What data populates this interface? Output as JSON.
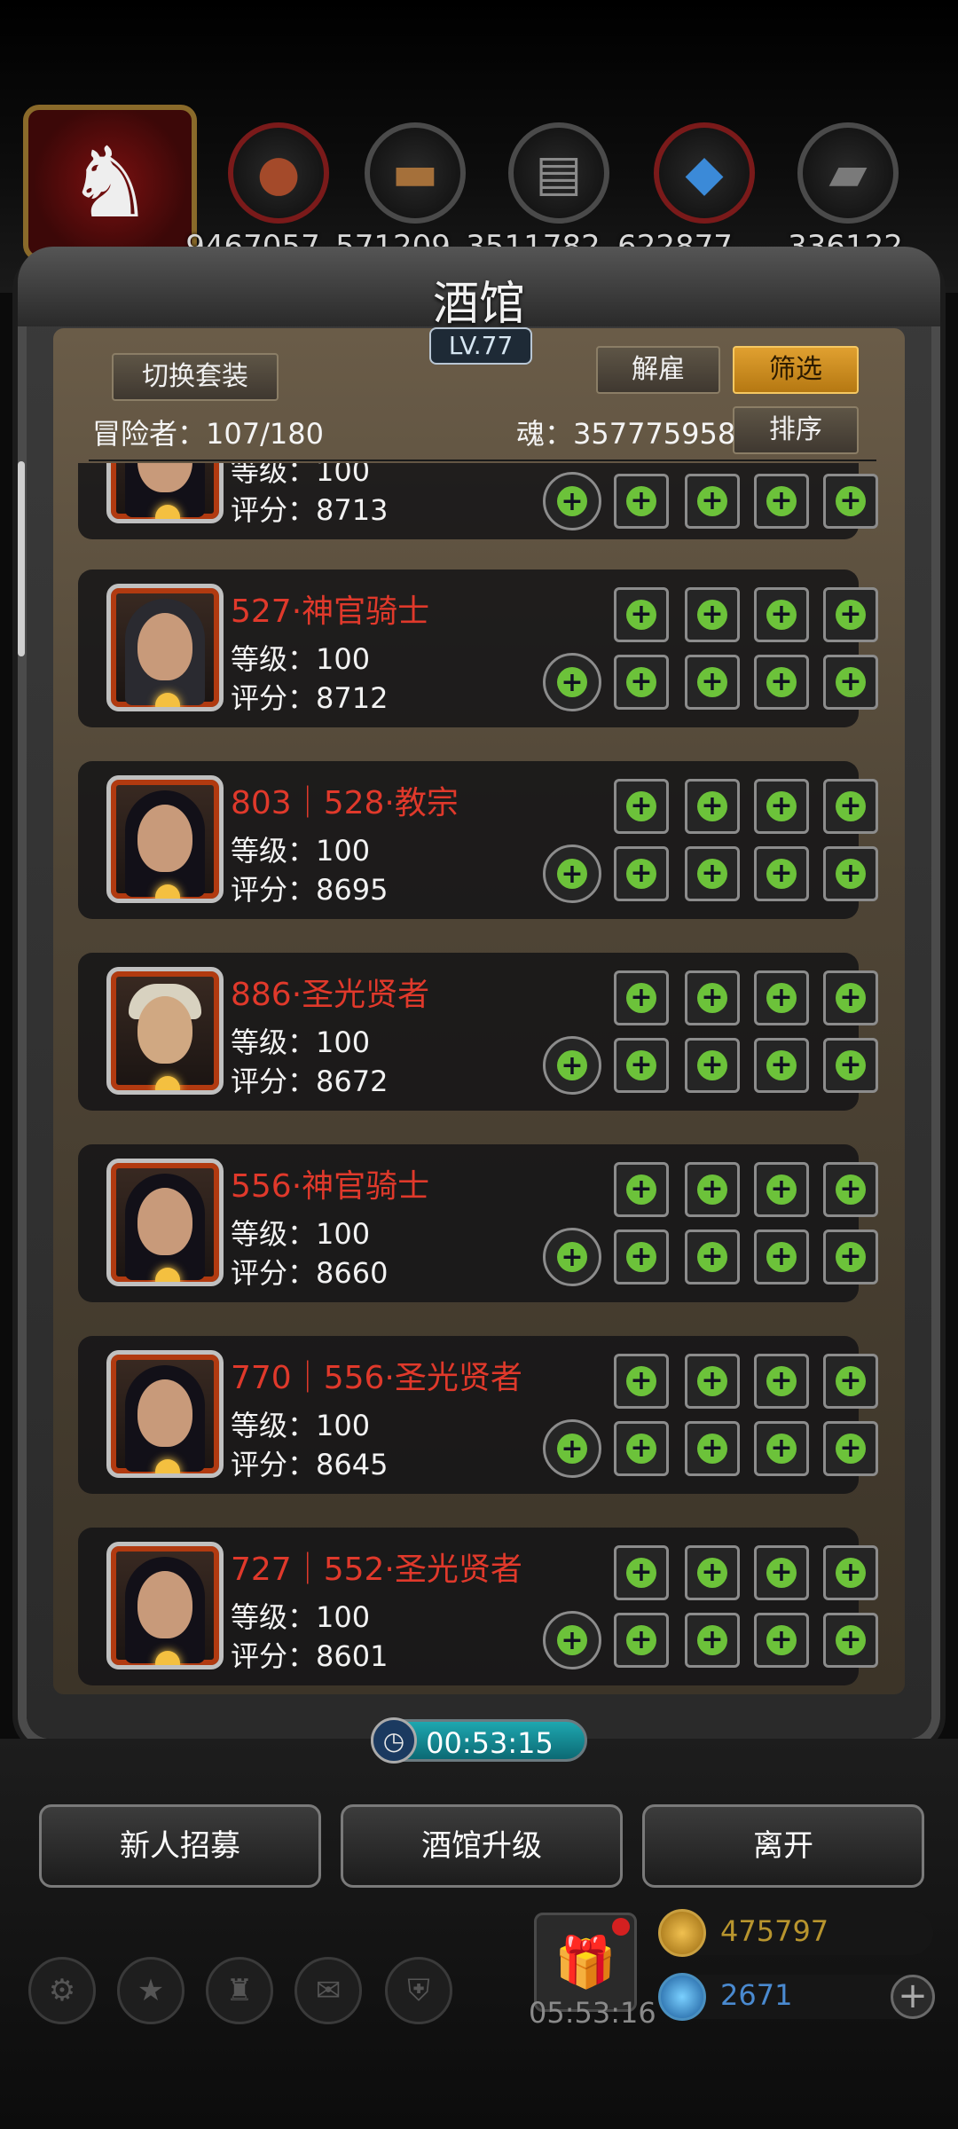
{
  "resources": [
    {
      "icon": "meat-icon",
      "value": "9467057"
    },
    {
      "icon": "wood-icon",
      "value": "571209"
    },
    {
      "icon": "iron-icon",
      "value": "3511782"
    },
    {
      "icon": "crystal-icon",
      "value": "622877"
    },
    {
      "icon": "stone-icon",
      "value": "336122"
    }
  ],
  "panel": {
    "title": "酒馆",
    "level": "LV.77",
    "switch_set_label": "切换套装",
    "dismiss_label": "解雇",
    "filter_label": "筛选",
    "sort_label": "排序",
    "adventurer_label": "冒险者：107/180",
    "soul_label": "魂：357775958"
  },
  "heroes": [
    {
      "name": "",
      "level": "等级：100",
      "score": "评分：8713"
    },
    {
      "name": "527·神官骑士",
      "level": "等级：100",
      "score": "评分：8712"
    },
    {
      "name": "803｜528·教宗",
      "level": "等级：100",
      "score": "评分：8695"
    },
    {
      "name": "886·圣光贤者",
      "level": "等级：100",
      "score": "评分：8672"
    },
    {
      "name": "556·神官骑士",
      "level": "等级：100",
      "score": "评分：8660"
    },
    {
      "name": "770｜556·圣光贤者",
      "level": "等级：100",
      "score": "评分：8645"
    },
    {
      "name": "727｜552·圣光贤者",
      "level": "等级：100",
      "score": "评分：8601"
    }
  ],
  "timer": "00:53:15",
  "actions": {
    "recruit": "新人招募",
    "upgrade": "酒馆升级",
    "leave": "离开"
  },
  "gift_timer": "05:53:16",
  "currency": {
    "gold": "475797",
    "gems": "2671"
  },
  "colors": {
    "hero_name": "#e0392b",
    "accent_gold": "#e0a030",
    "timer_bar": "#1ea7b0",
    "slot_plus": "#6cc23a"
  }
}
